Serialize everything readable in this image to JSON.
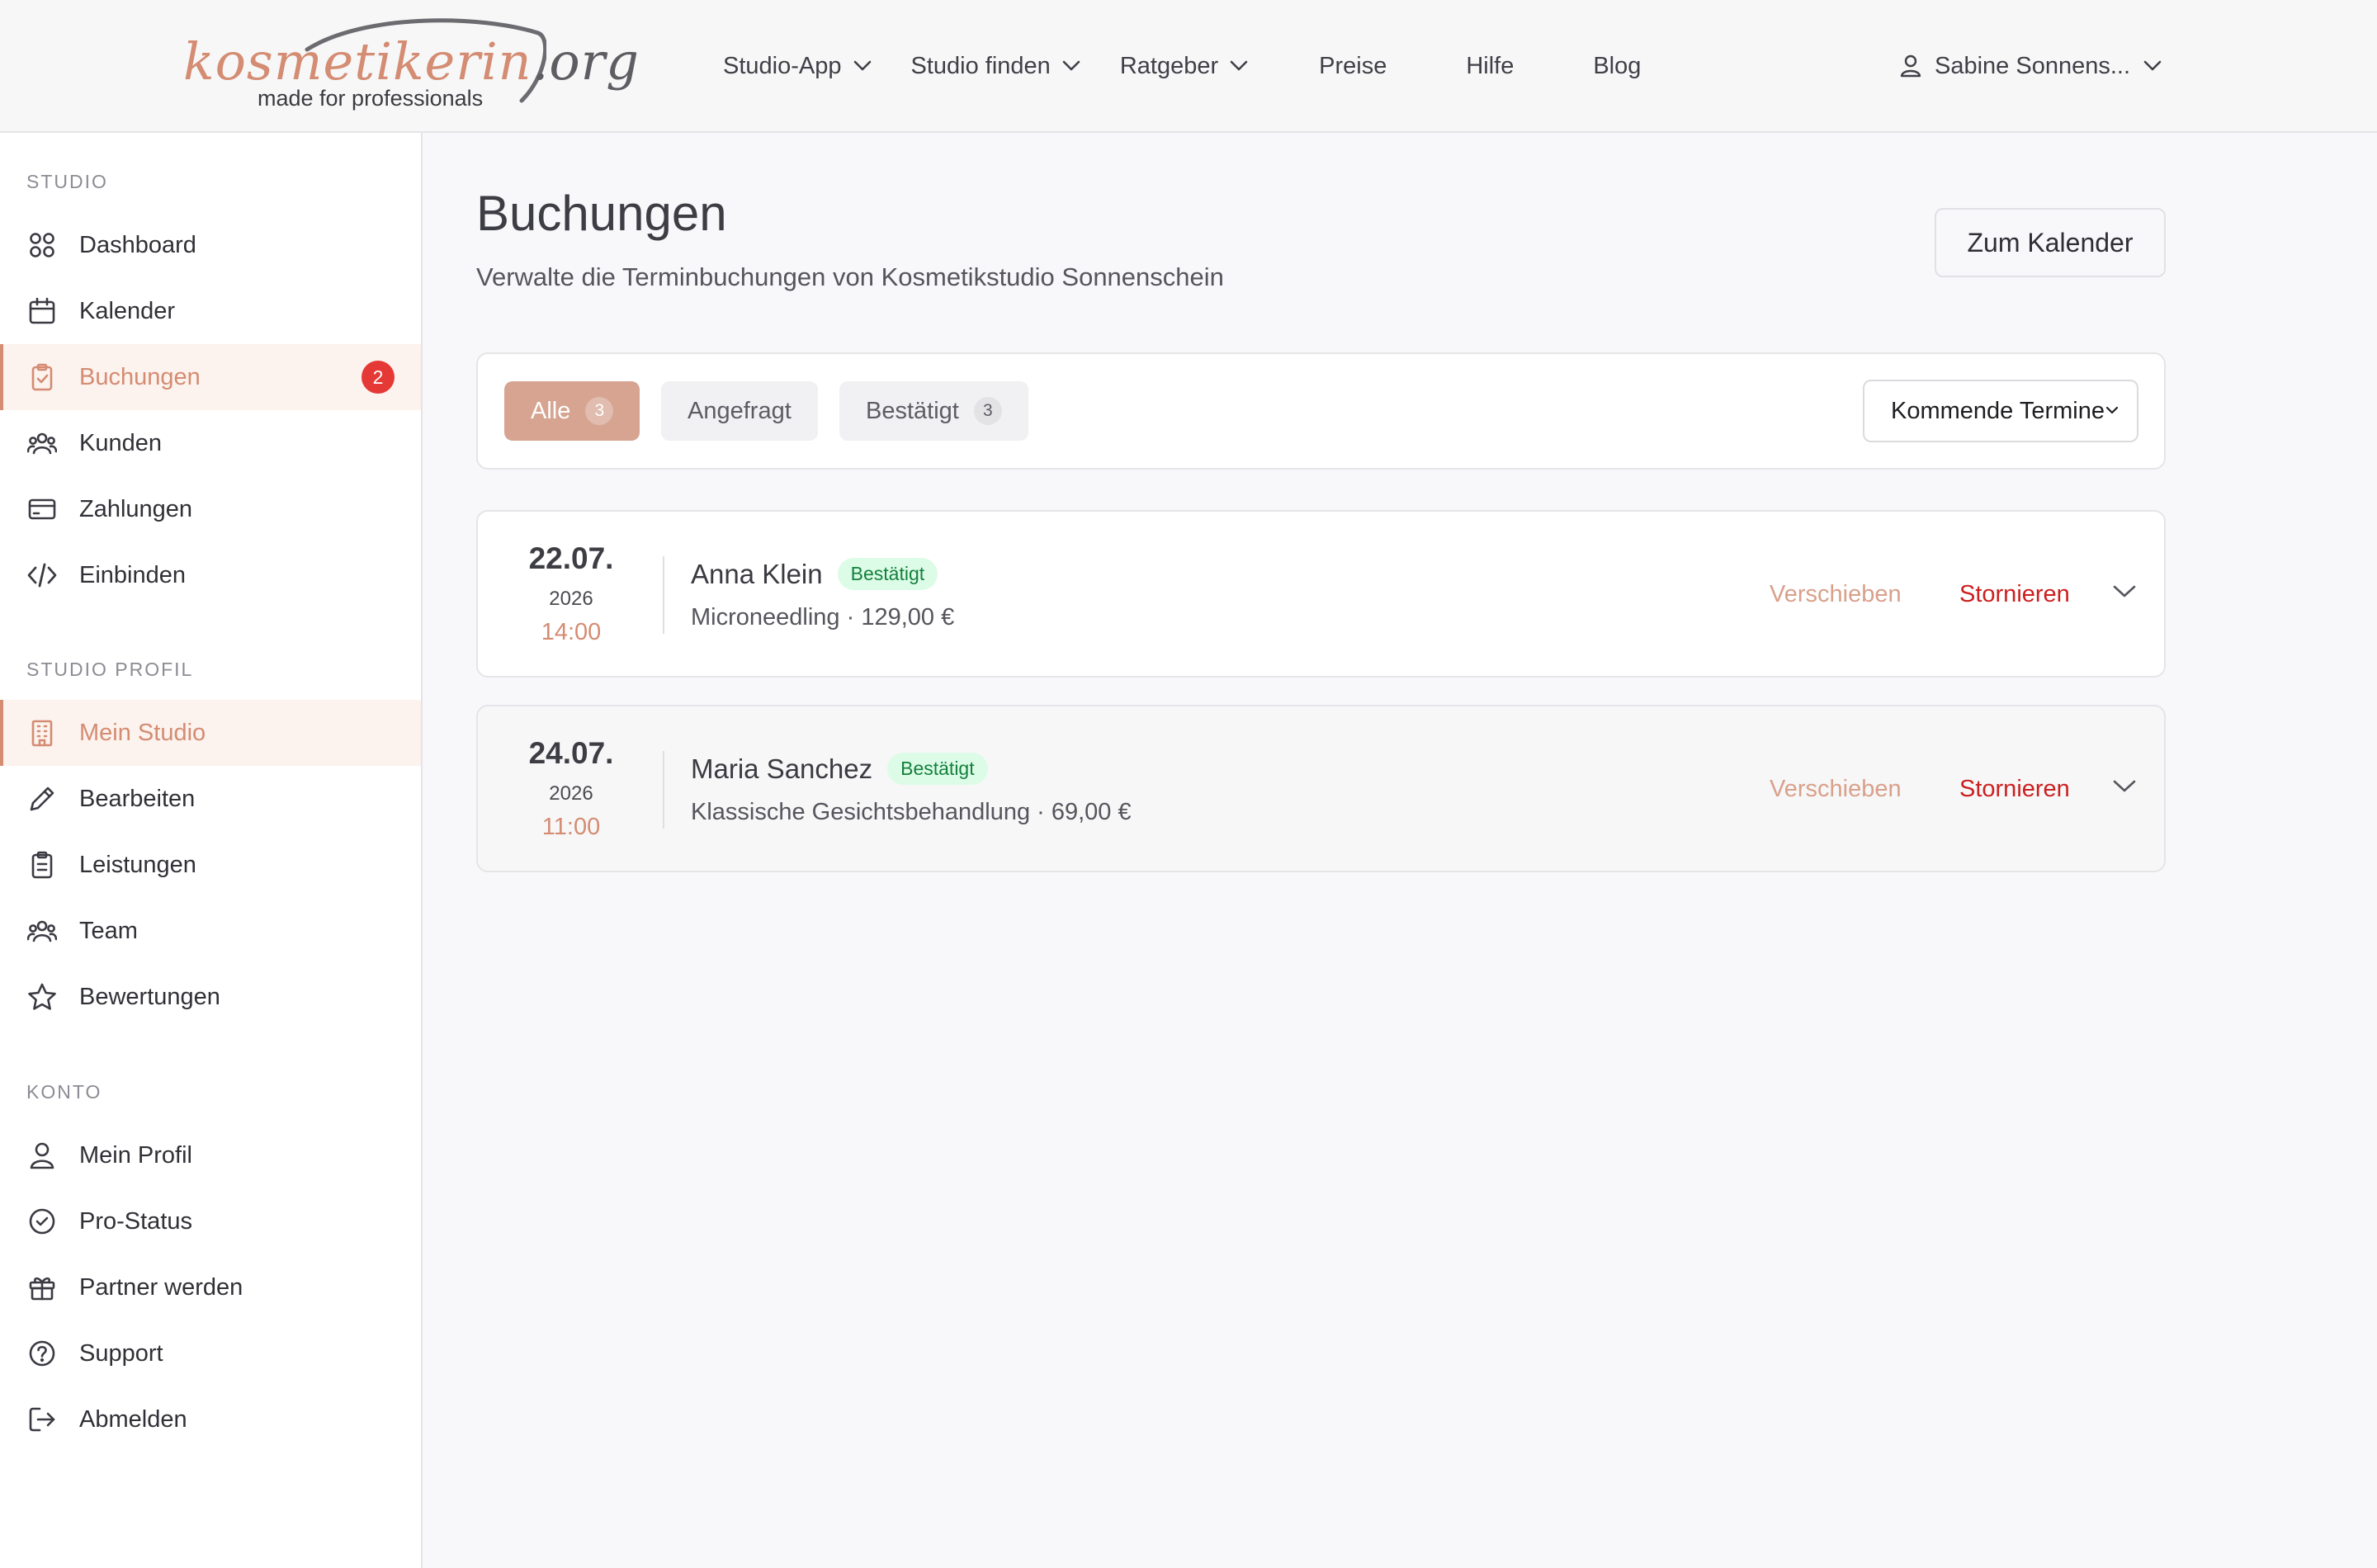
{
  "brand": {
    "logo_name": "kosmetikerin",
    "logo_tld": ".org",
    "logo_tagline": "made for professionals",
    "accent_color": "#d48c72"
  },
  "nav": {
    "items": [
      {
        "label": "Studio-App",
        "dropdown": true
      },
      {
        "label": "Studio finden",
        "dropdown": true
      },
      {
        "label": "Ratgeber",
        "dropdown": true
      },
      {
        "label": "Preise",
        "dropdown": false
      },
      {
        "label": "Hilfe",
        "dropdown": false
      },
      {
        "label": "Blog",
        "dropdown": false
      }
    ],
    "user_name": "Sabine Sonnens...",
    "user_icon": "user-icon"
  },
  "sidebar": {
    "sections": [
      {
        "title": "STUDIO",
        "items": [
          {
            "label": "Dashboard",
            "icon": "grid-icon"
          },
          {
            "label": "Kalender",
            "icon": "calendar-icon"
          },
          {
            "label": "Buchungen",
            "icon": "clipboard-check-icon",
            "active": true,
            "badge": "2"
          },
          {
            "label": "Kunden",
            "icon": "users-icon"
          },
          {
            "label": "Zahlungen",
            "icon": "credit-card-icon"
          },
          {
            "label": "Einbinden",
            "icon": "code-icon"
          }
        ]
      },
      {
        "title": "STUDIO PROFIL",
        "items": [
          {
            "label": "Mein Studio",
            "icon": "building-icon",
            "active": true
          },
          {
            "label": "Bearbeiten",
            "icon": "pencil-icon"
          },
          {
            "label": "Leistungen",
            "icon": "clipboard-list-icon"
          },
          {
            "label": "Team",
            "icon": "team-icon"
          },
          {
            "label": "Bewertungen",
            "icon": "star-icon"
          }
        ]
      },
      {
        "title": "KONTO",
        "items": [
          {
            "label": "Mein Profil",
            "icon": "user-icon"
          },
          {
            "label": "Pro-Status",
            "icon": "check-circle-icon"
          },
          {
            "label": "Partner werden",
            "icon": "gift-icon"
          },
          {
            "label": "Support",
            "icon": "help-circle-icon"
          },
          {
            "label": "Abmelden",
            "icon": "logout-icon"
          }
        ]
      }
    ]
  },
  "page": {
    "title": "Buchungen",
    "subtitle": "Verwalte die Terminbuchungen von Kosmetikstudio Sonnenschein",
    "calendar_button": "Zum Kalender"
  },
  "filters": {
    "tabs": [
      {
        "label": "Alle",
        "count": "3",
        "active": true
      },
      {
        "label": "Angefragt",
        "count": null,
        "active": false
      },
      {
        "label": "Bestätigt",
        "count": "3",
        "active": false
      }
    ],
    "select_value": "Kommende Termine"
  },
  "bookings": [
    {
      "day": "22.07.",
      "year": "2026",
      "time": "14:00",
      "name": "Anna Klein",
      "status": "Bestätigt",
      "service": "Microneedling · 129,00 €",
      "move_label": "Verschieben",
      "cancel_label": "Stornieren"
    },
    {
      "day": "24.07.",
      "year": "2026",
      "time": "11:00",
      "name": "Maria Sanchez",
      "status": "Bestätigt",
      "service": "Klassische Gesichtsbehandlung · 69,00 €",
      "move_label": "Verschieben",
      "cancel_label": "Stornieren"
    }
  ],
  "colors": {
    "status_confirmed_bg": "#dcfce7",
    "status_confirmed_text": "#15803d",
    "cancel_red": "#cc1f1f",
    "badge_red": "#e53935"
  }
}
